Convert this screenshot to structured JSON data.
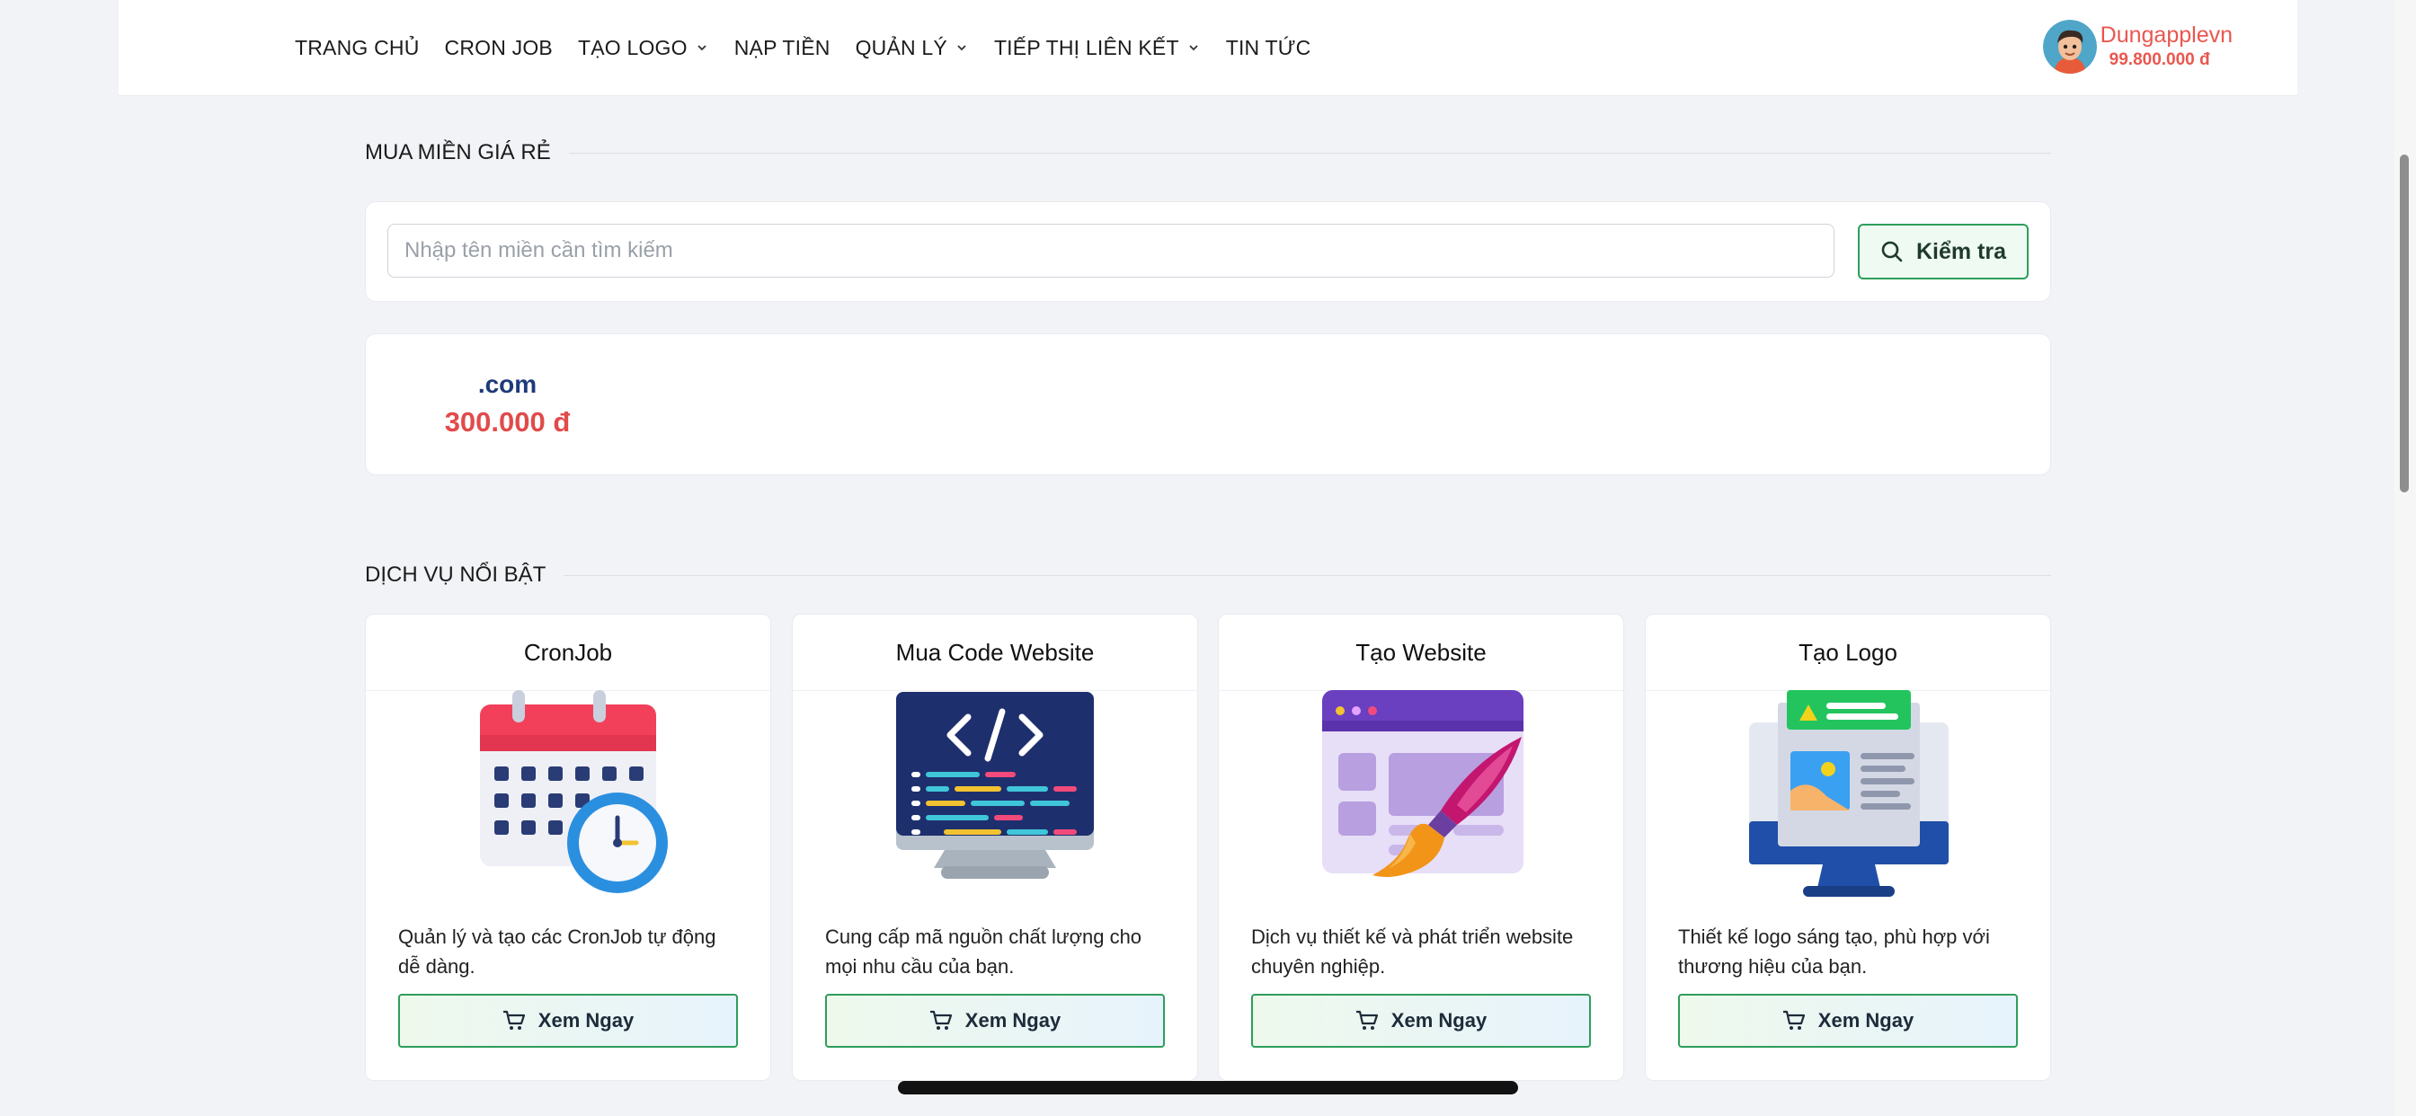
{
  "nav": {
    "menu": [
      {
        "label": "TRANG CHỦ",
        "dropdown": false
      },
      {
        "label": "CRON JOB",
        "dropdown": false
      },
      {
        "label": "TẠO LOGO",
        "dropdown": true
      },
      {
        "label": "NẠP TIỀN",
        "dropdown": false
      },
      {
        "label": "QUẢN LÝ",
        "dropdown": true
      },
      {
        "label": "TIẾP THỊ LIÊN KẾT",
        "dropdown": true
      },
      {
        "label": "TIN TỨC",
        "dropdown": false
      }
    ],
    "user": {
      "name": "Dungapplevn",
      "balance": "99.800.000 đ"
    }
  },
  "domain_section": {
    "title": "MUA MIỀN GIÁ RẺ",
    "search_placeholder": "Nhập tên miền cần tìm kiếm",
    "search_button": "Kiểm tra",
    "prices": [
      {
        "ext": ".com",
        "price": "300.000 đ"
      }
    ]
  },
  "services_section": {
    "title": "DỊCH VỤ NỔI BẬT",
    "items": [
      {
        "title": "CronJob",
        "icon": "calendar-clock-icon",
        "description": "Quản lý và tạo các CronJob tự động dễ dàng.",
        "button": "Xem Ngay"
      },
      {
        "title": "Mua Code Website",
        "icon": "code-monitor-icon",
        "description": "Cung cấp mã nguồn chất lượng cho mọi nhu cầu của bạn.",
        "button": "Xem Ngay"
      },
      {
        "title": "Tạo Website",
        "icon": "web-design-brush-icon",
        "description": "Dịch vụ thiết kế và phát triển website chuyên nghiệp.",
        "button": "Xem Ngay"
      },
      {
        "title": "Tạo Logo",
        "icon": "logo-design-monitor-icon",
        "description": "Thiết kế logo sáng tạo, phù hợp với thương hiệu của bạn.",
        "button": "Xem Ngay"
      }
    ]
  },
  "colors": {
    "accent_red": "#e9574f",
    "accent_green": "#2e9e5b",
    "domain_blue": "#1e3a78"
  }
}
